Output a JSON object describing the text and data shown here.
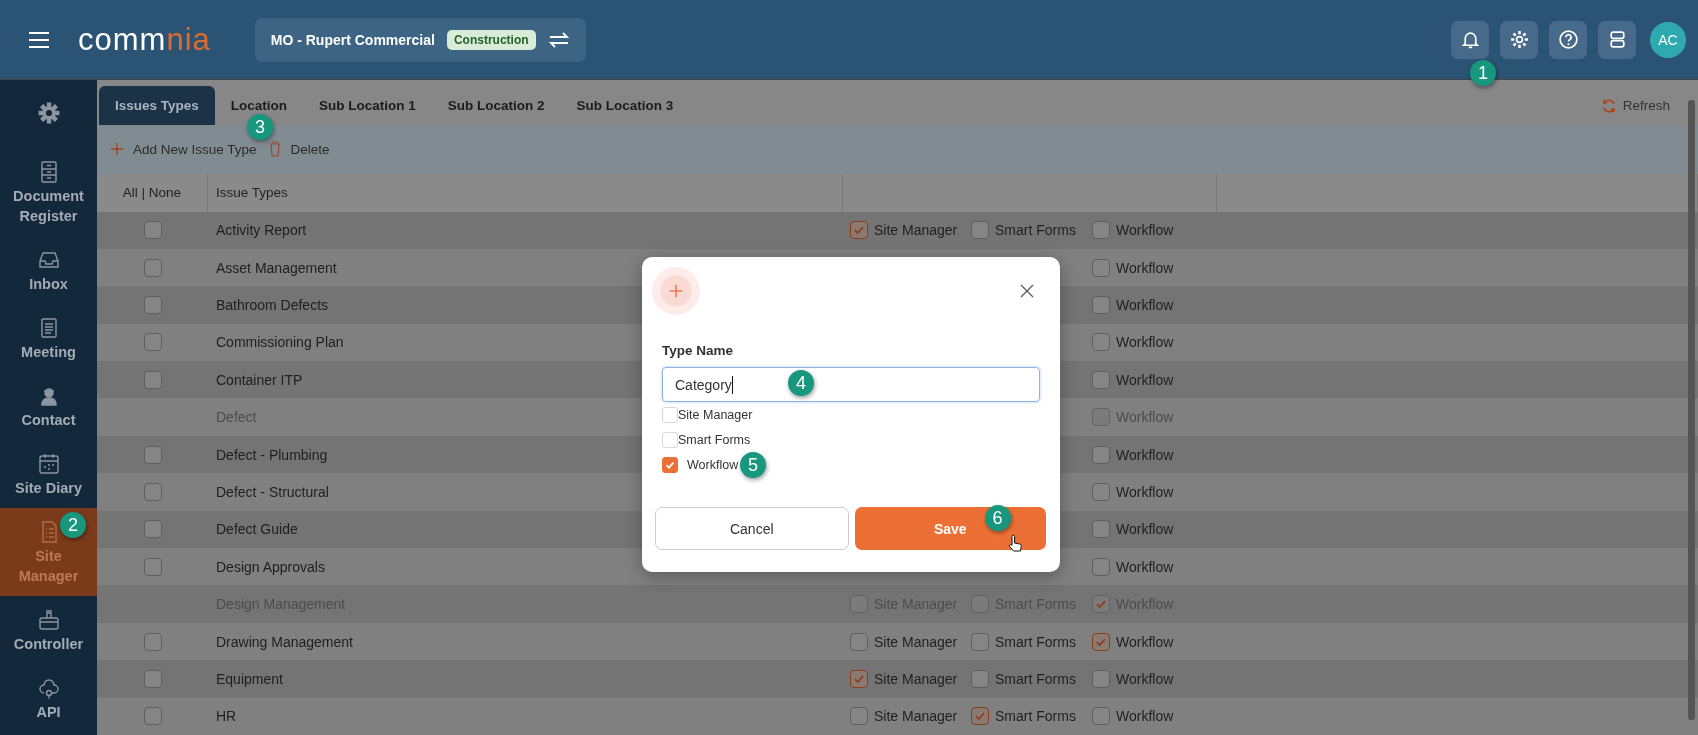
{
  "header": {
    "logo": {
      "part_1": "comm",
      "part_2": "nia"
    },
    "project": {
      "name": "MO - Rupert Commercial",
      "badge": "Construction"
    },
    "bell_callout": "1",
    "avatar": "AC"
  },
  "sidebar": {
    "items": [
      {
        "label": "Document Register",
        "selected": false
      },
      {
        "label": "Inbox",
        "selected": false
      },
      {
        "label": "Meeting",
        "selected": false
      },
      {
        "label": "Contact",
        "selected": false
      },
      {
        "label": "Site Diary",
        "selected": false
      },
      {
        "label": "Site Manager",
        "selected": true,
        "callout": "2"
      },
      {
        "label": "Controller",
        "selected": false
      },
      {
        "label": "API",
        "selected": false
      }
    ]
  },
  "tabs": [
    {
      "label": "Issues Types",
      "selected": true
    },
    {
      "label": "Location",
      "selected": false
    },
    {
      "label": "Sub Location 1",
      "selected": false
    },
    {
      "label": "Sub Location 2",
      "selected": false
    },
    {
      "label": "Sub Location 3",
      "selected": false
    }
  ],
  "refresh": "Refresh",
  "toolbar": {
    "add": "Add New Issue Type",
    "add_callout": "3",
    "delete": "Delete"
  },
  "table": {
    "columns": [
      "All | None",
      "Issue Types"
    ],
    "rows": [
      {
        "name": "Activity Report",
        "disabled": false,
        "selected": false,
        "perms": [
          {
            "kind": "site_manager",
            "label": "Site Manager",
            "checked": true
          },
          {
            "kind": "smart_forms",
            "label": "Smart Forms",
            "checked": false
          },
          {
            "kind": "workflow",
            "label": "Workflow",
            "checked": false
          }
        ]
      },
      {
        "name": "Asset Management",
        "disabled": false,
        "selected": false,
        "perms": [
          {
            "kind": "workflow",
            "label": "Workflow",
            "checked": false
          }
        ]
      },
      {
        "name": "Bathroom Defects",
        "disabled": false,
        "selected": false,
        "perms": [
          {
            "kind": "workflow",
            "label": "Workflow",
            "checked": false
          }
        ]
      },
      {
        "name": "Commissioning Plan",
        "disabled": false,
        "selected": false,
        "perms": [
          {
            "kind": "workflow",
            "label": "Workflow",
            "checked": false
          }
        ]
      },
      {
        "name": "Container ITP",
        "disabled": false,
        "selected": false,
        "perms": [
          {
            "kind": "workflow",
            "label": "Workflow",
            "checked": false
          }
        ]
      },
      {
        "name": "Defect",
        "disabled": true,
        "perms": [
          {
            "kind": "workflow",
            "label": "Workflow",
            "checked": false
          }
        ]
      },
      {
        "name": "Defect - Plumbing",
        "disabled": false,
        "selected": false,
        "perms": [
          {
            "kind": "workflow",
            "label": "Workflow",
            "checked": false
          }
        ]
      },
      {
        "name": "Defect - Structural",
        "disabled": false,
        "selected": false,
        "perms": [
          {
            "kind": "workflow",
            "label": "Workflow",
            "checked": false
          }
        ]
      },
      {
        "name": "Defect Guide",
        "disabled": false,
        "selected": false,
        "perms": [
          {
            "kind": "workflow",
            "label": "Workflow",
            "checked": false
          }
        ]
      },
      {
        "name": "Design Approvals",
        "disabled": false,
        "selected": false,
        "perms": [
          {
            "kind": "workflow",
            "label": "Workflow",
            "checked": false
          }
        ]
      },
      {
        "name": "Design Management",
        "disabled": true,
        "perms": [
          {
            "kind": "site_manager",
            "label": "Site Manager",
            "checked": false
          },
          {
            "kind": "smart_forms",
            "label": "Smart Forms",
            "checked": false
          },
          {
            "kind": "workflow",
            "label": "Workflow",
            "checked": true
          }
        ]
      },
      {
        "name": "Drawing Management",
        "disabled": false,
        "selected": false,
        "perms": [
          {
            "kind": "site_manager",
            "label": "Site Manager",
            "checked": false
          },
          {
            "kind": "smart_forms",
            "label": "Smart Forms",
            "checked": false
          },
          {
            "kind": "workflow",
            "label": "Workflow",
            "checked": true
          }
        ]
      },
      {
        "name": "Equipment",
        "disabled": false,
        "selected": false,
        "perms": [
          {
            "kind": "site_manager",
            "label": "Site Manager",
            "checked": true
          },
          {
            "kind": "smart_forms",
            "label": "Smart Forms",
            "checked": false
          },
          {
            "kind": "workflow",
            "label": "Workflow",
            "checked": false
          }
        ]
      },
      {
        "name": "HR",
        "disabled": false,
        "selected": false,
        "perms": [
          {
            "kind": "site_manager",
            "label": "Site Manager",
            "checked": false
          },
          {
            "kind": "smart_forms",
            "label": "Smart Forms",
            "checked": true
          },
          {
            "kind": "workflow",
            "label": "Workflow",
            "checked": false
          }
        ]
      }
    ]
  },
  "dialog": {
    "label": "Type Name",
    "value": "Category",
    "value_callout": "4",
    "options": [
      {
        "label": "Site Manager",
        "checked": false
      },
      {
        "label": "Smart Forms",
        "checked": false
      },
      {
        "label": "Workflow",
        "checked": true,
        "callout": "5"
      }
    ],
    "cancel": "Cancel",
    "save": "Save",
    "save_callout": "6"
  }
}
